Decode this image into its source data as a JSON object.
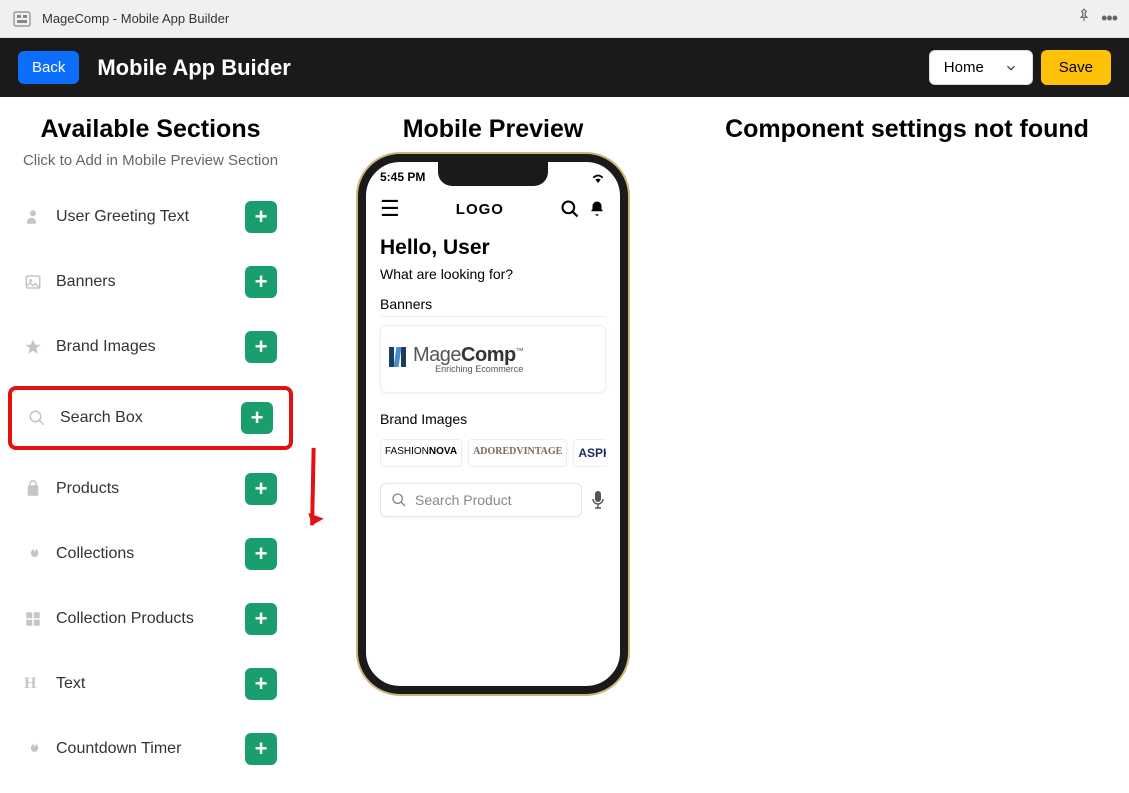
{
  "app": {
    "title": "MageComp - Mobile App Builder"
  },
  "toolbar": {
    "back": "Back",
    "title": "Mobile App Buider",
    "home": "Home",
    "save": "Save"
  },
  "left": {
    "title": "Available Sections",
    "subtitle": "Click to Add in Mobile Preview Section",
    "items": [
      {
        "label": "User Greeting Text",
        "icon": "person",
        "highlight": false
      },
      {
        "label": "Banners",
        "icon": "image",
        "highlight": false
      },
      {
        "label": "Brand Images",
        "icon": "star",
        "highlight": false
      },
      {
        "label": "Search Box",
        "icon": "search",
        "highlight": true
      },
      {
        "label": "Products",
        "icon": "bag",
        "highlight": false
      },
      {
        "label": "Collections",
        "icon": "flame",
        "highlight": false
      },
      {
        "label": "Collection Products",
        "icon": "grid",
        "highlight": false
      },
      {
        "label": "Text",
        "icon": "H",
        "highlight": false
      },
      {
        "label": "Countdown Timer",
        "icon": "flame",
        "highlight": false
      }
    ]
  },
  "mid": {
    "title": "Mobile Preview",
    "phone": {
      "time": "5:45 PM",
      "logo": "LOGO",
      "hello": "Hello, User",
      "question": "What are looking for?",
      "sec_banners": "Banners",
      "mc_main_1": "Mage",
      "mc_main_2": "Comp",
      "mc_sub": "Enriching Ecommerce",
      "sec_brands": "Brand Images",
      "brand1_a": "FASHION",
      "brand1_b": "NOVA",
      "brand2": "ADOREDVINTAGE",
      "brand3": "ASPH",
      "search_placeholder": "Search Product"
    }
  },
  "right": {
    "title": "Component settings not found"
  }
}
